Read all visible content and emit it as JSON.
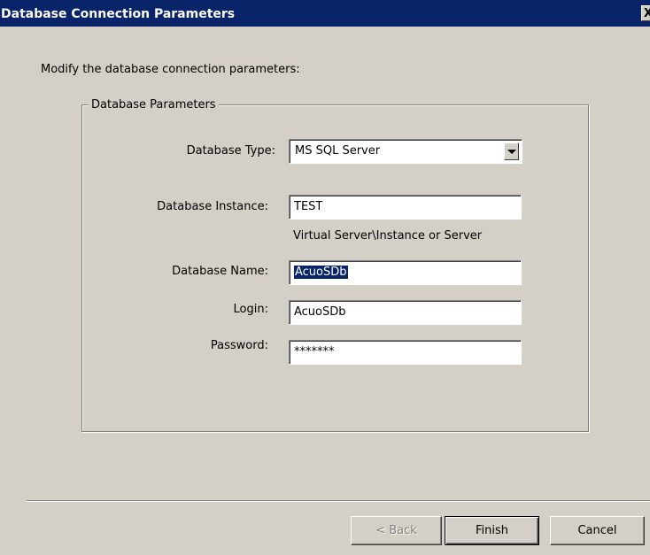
{
  "window": {
    "title": "Database Connection Parameters",
    "close_glyph": "X"
  },
  "instruction": "Modify the database connection parameters:",
  "group": {
    "legend": "Database Parameters",
    "database_type": {
      "label": "Database Type:",
      "value": "MS SQL Server"
    },
    "database_instance": {
      "label": "Database Instance:",
      "value": "TEST",
      "hint": "Virtual Server\\Instance  or  Server"
    },
    "database_name": {
      "label": "Database Name:",
      "value": "AcuoSDb"
    },
    "login": {
      "label": "Login:",
      "value": "AcuoSDb"
    },
    "password": {
      "label": "Password:",
      "value": "*******"
    }
  },
  "buttons": {
    "back": "< Back",
    "finish": "Finish",
    "cancel": "Cancel"
  },
  "colors": {
    "titlebar": "#0a246a",
    "dialog_background": "#d4d0c8",
    "selection": "#0a246a"
  },
  "icons": {
    "close": "close-icon",
    "dropdown": "chevron-down-icon"
  }
}
